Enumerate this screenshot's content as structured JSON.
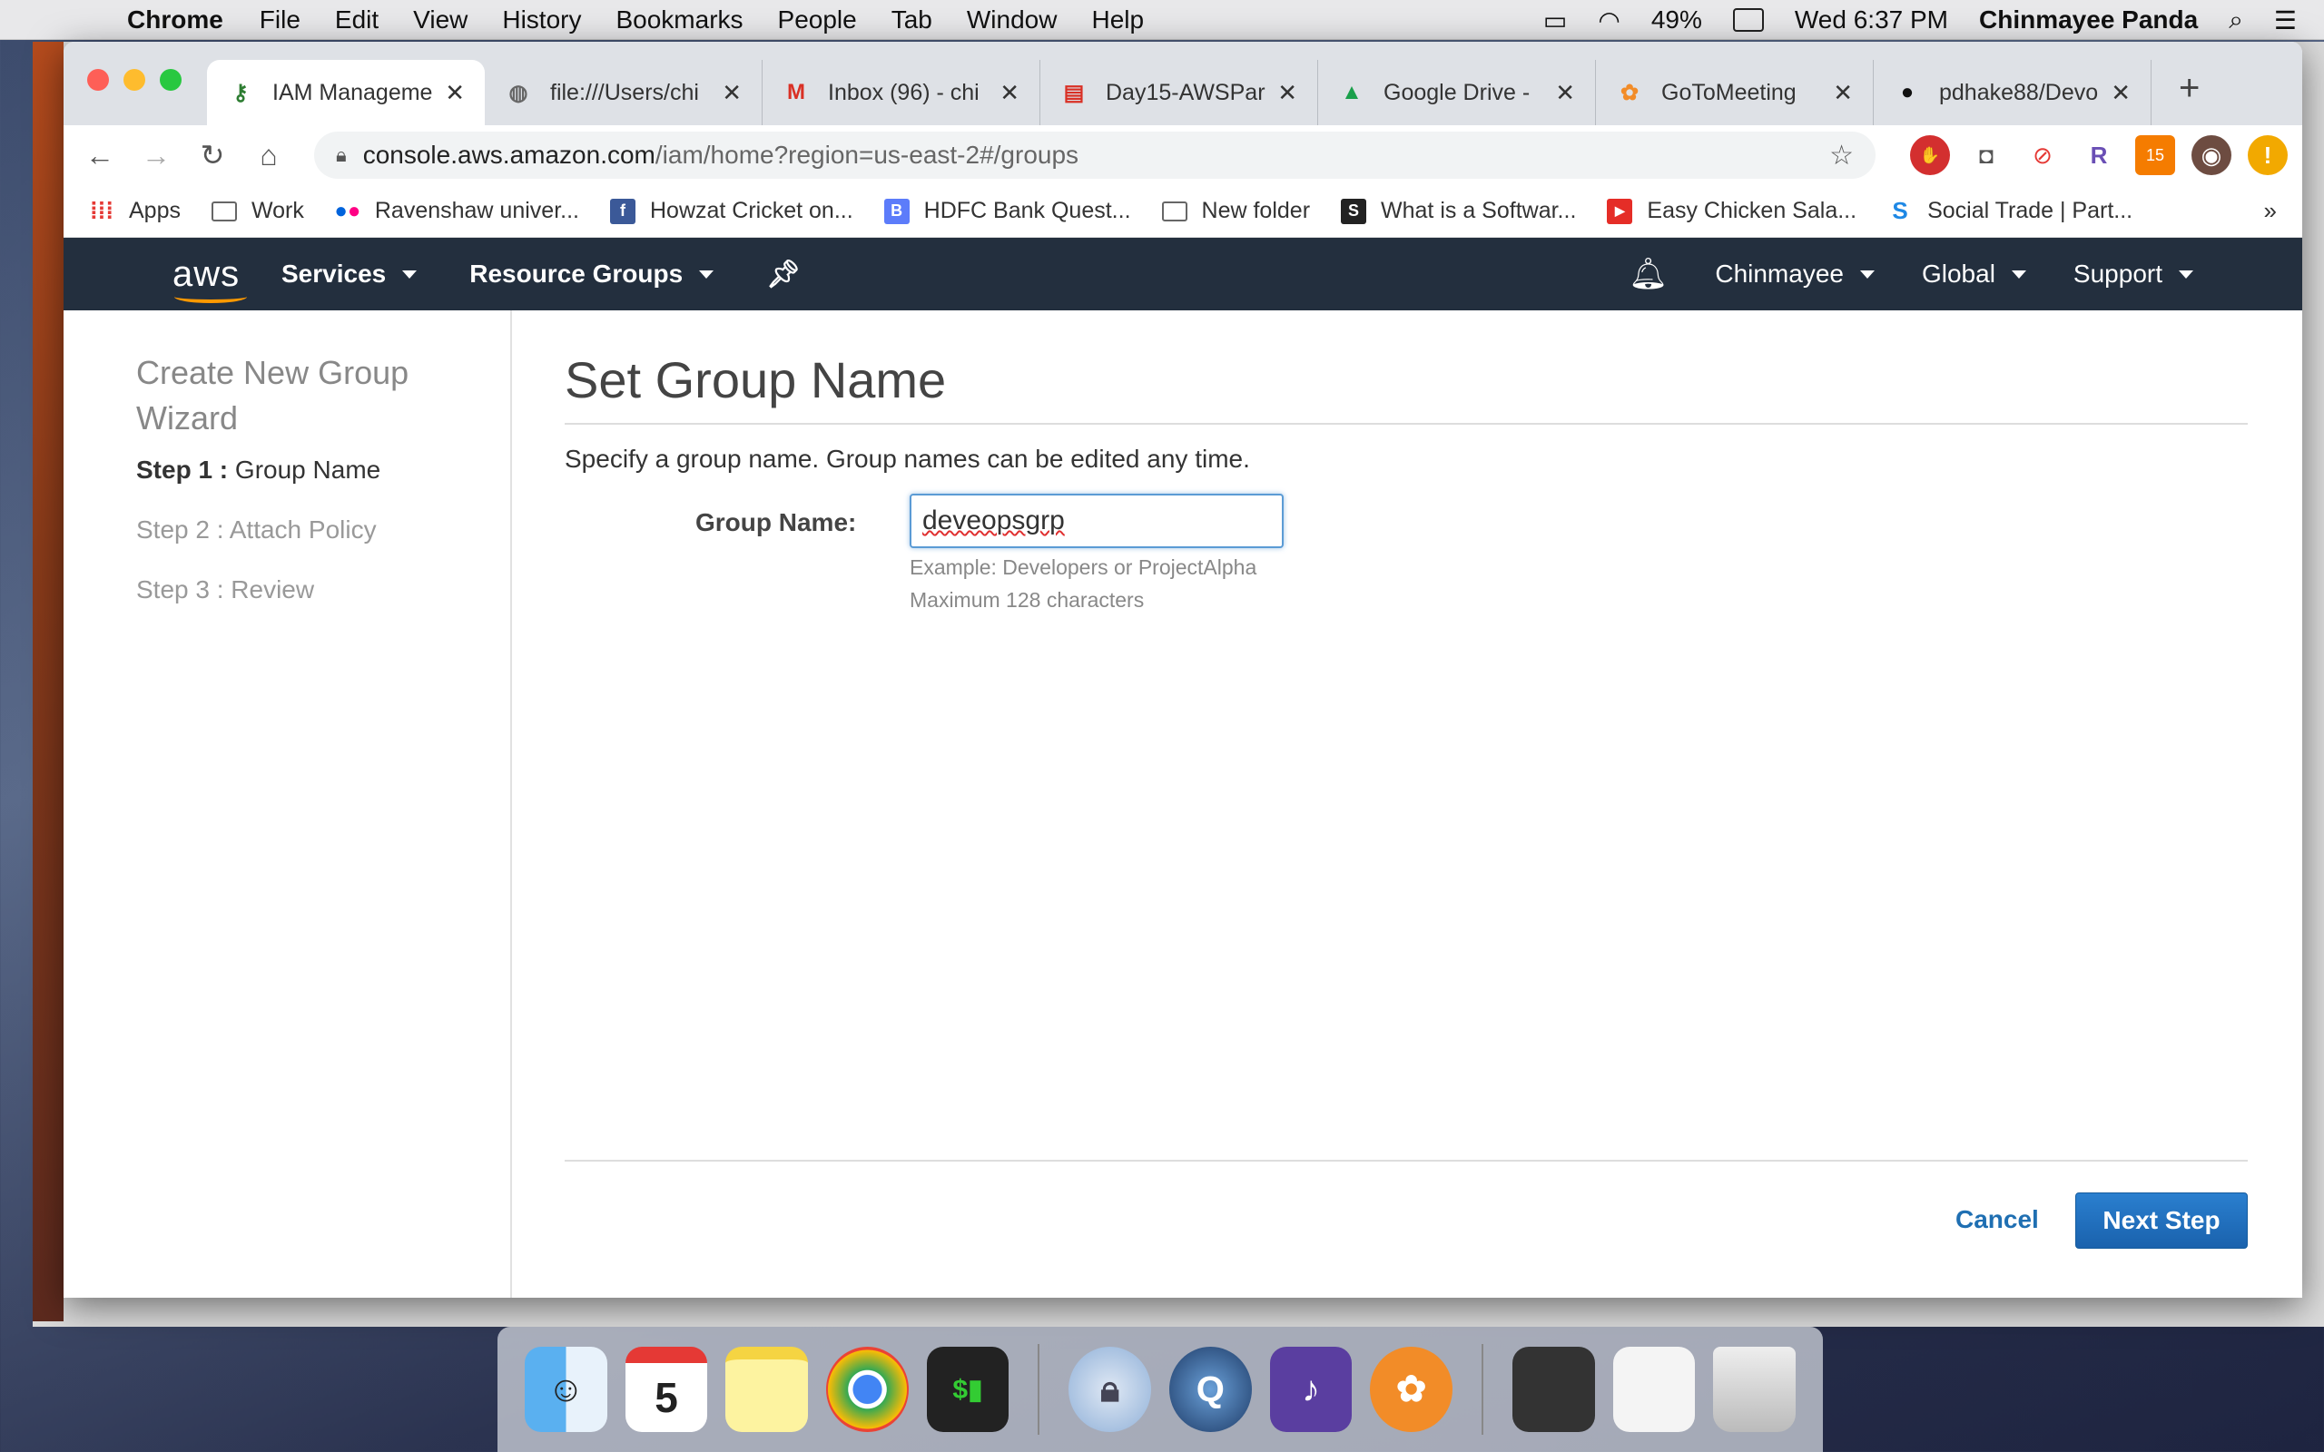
{
  "menubar": {
    "app": "Chrome",
    "items": [
      "File",
      "Edit",
      "View",
      "History",
      "Bookmarks",
      "People",
      "Tab",
      "Window",
      "Help"
    ],
    "battery": "49%",
    "datetime": "Wed 6:37 PM",
    "user": "Chinmayee Panda"
  },
  "tabs": [
    {
      "title": "IAM Manageme",
      "icon": "key-icon",
      "active": true
    },
    {
      "title": "file:///Users/chi",
      "icon": "globe-icon"
    },
    {
      "title": "Inbox (96) - chi",
      "icon": "gmail-icon"
    },
    {
      "title": "Day15-AWSPar",
      "icon": "slides-icon"
    },
    {
      "title": "Google Drive - ",
      "icon": "drive-icon"
    },
    {
      "title": "GoToMeeting",
      "icon": "gotomeeting-icon"
    },
    {
      "title": "pdhake88/Devo",
      "icon": "github-icon"
    }
  ],
  "address": {
    "domain": "console.aws.amazon.com",
    "path": "/iam/home?region=us-east-2#/groups"
  },
  "bookmarks": [
    {
      "label": "Apps",
      "icon": "apps-grid-icon"
    },
    {
      "label": "Work",
      "icon": "folder-icon"
    },
    {
      "label": "Ravenshaw univer...",
      "icon": "flickr-icon"
    },
    {
      "label": "Howzat Cricket on...",
      "icon": "facebook-icon"
    },
    {
      "label": "HDFC Bank Quest...",
      "icon": "b-icon"
    },
    {
      "label": "New folder",
      "icon": "folder-icon"
    },
    {
      "label": "What is a Softwar...",
      "icon": "s-logo-icon"
    },
    {
      "label": "Easy Chicken Sala...",
      "icon": "youtube-icon"
    },
    {
      "label": "Social Trade | Part...",
      "icon": "st-logo-icon"
    }
  ],
  "aws": {
    "logo": "aws",
    "services": "Services",
    "resource_groups": "Resource Groups",
    "account": "Chinmayee",
    "region": "Global",
    "support": "Support"
  },
  "wizard": {
    "title": "Create New Group Wizard",
    "steps": [
      {
        "prefix": "Step 1 :",
        "label": "Group Name"
      },
      {
        "prefix": "Step 2 :",
        "label": "Attach Policy"
      },
      {
        "prefix": "Step 3 :",
        "label": "Review"
      }
    ]
  },
  "form": {
    "heading": "Set Group Name",
    "description": "Specify a group name. Group names can be edited any time.",
    "field_label": "Group Name:",
    "value": "deveopsgrp",
    "hint_example": "Example: Developers or ProjectAlpha",
    "hint_max": "Maximum 128 characters"
  },
  "actions": {
    "cancel": "Cancel",
    "next": "Next Step"
  },
  "colors": {
    "aws_nav": "#232f3e",
    "aws_orange": "#ff9900",
    "primary_button": "#1f6fb2"
  }
}
